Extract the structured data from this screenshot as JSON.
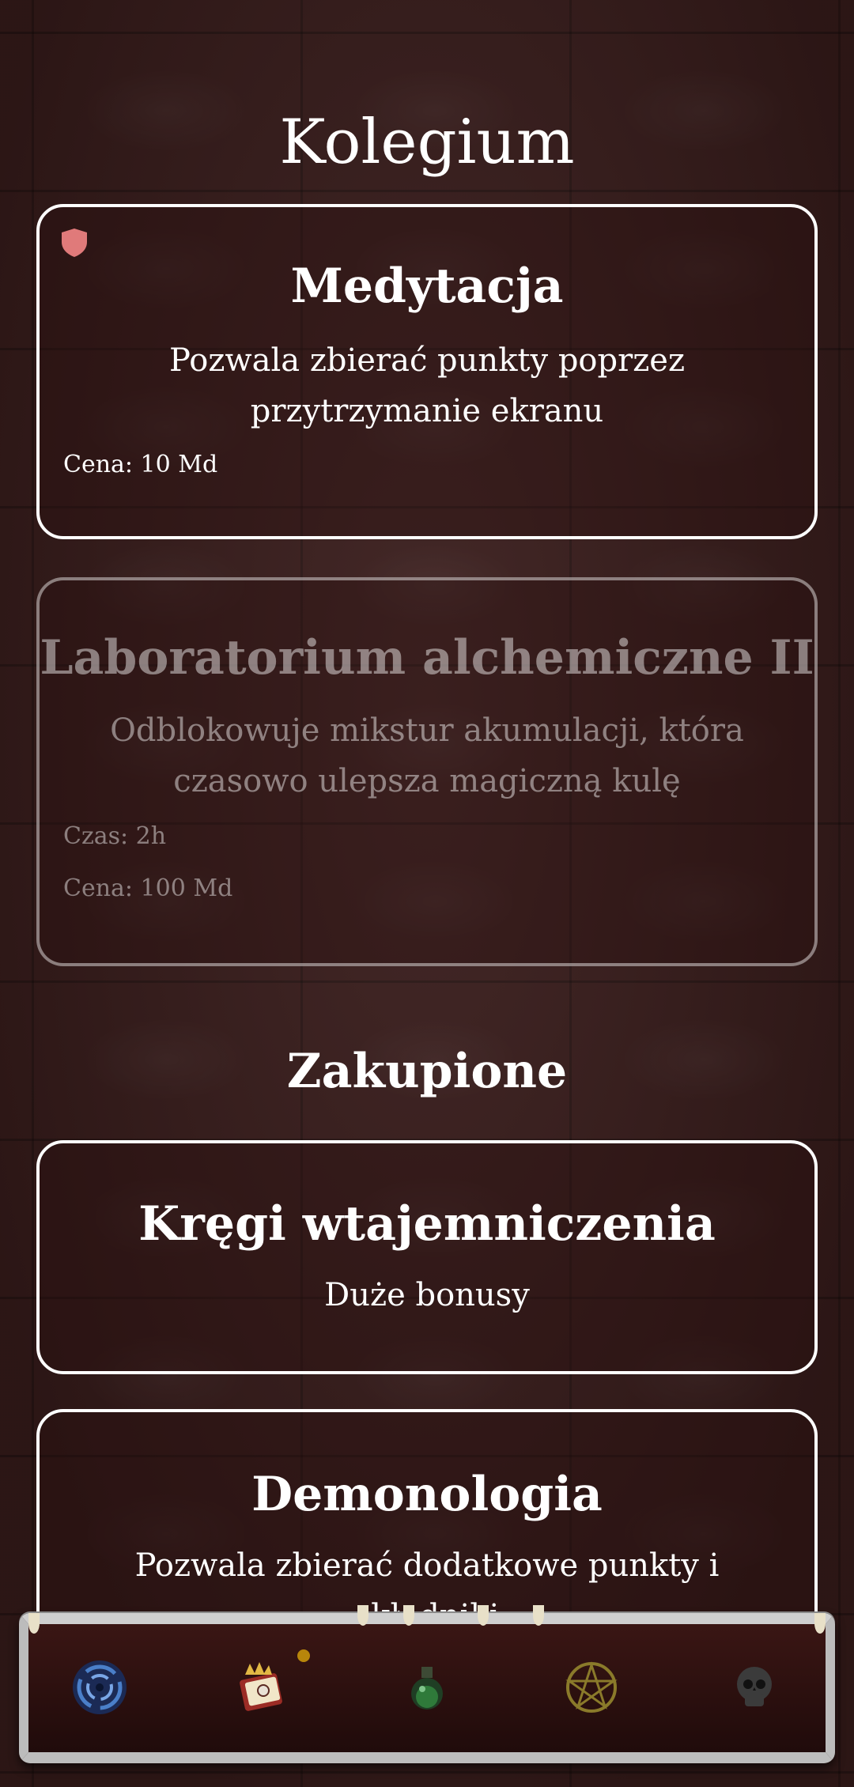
{
  "screen": {
    "title": "Kolegium"
  },
  "available": [
    {
      "title": "Medytacja",
      "description": "Pozwala zbierać punkty poprzez przytrzymanie ekranu",
      "cost": "Cena: 10 Md"
    },
    {
      "title": "Laboratorium alchemiczne II",
      "description": "Odblokowuje mikstur akumulacji, która czasowo ulepsza magiczną kulę",
      "time": "Czas: 2h",
      "cost": "Cena: 100 Md"
    }
  ],
  "purchased_section": {
    "title": "Zakupione"
  },
  "purchased": [
    {
      "title": "Kręgi wtajemniczenia",
      "description": "Duże bonusy"
    },
    {
      "title": "Demonologia",
      "description": "Pozwala zbierać dodatkowe punkty i składniki"
    }
  ],
  "nav": {
    "items": [
      {
        "icon": "vortex-icon",
        "active": false
      },
      {
        "icon": "spellbook-icon",
        "active": true,
        "has_notification": true
      },
      {
        "icon": "potion-icon",
        "active": false
      },
      {
        "icon": "pentagram-icon",
        "active": false
      },
      {
        "icon": "skull-icon",
        "active": false
      }
    ]
  },
  "colors": {
    "background": "#3a1d1c",
    "card_border": "#ffffff",
    "shield": "#e07a7a",
    "notification_dot": "#b8860b"
  }
}
